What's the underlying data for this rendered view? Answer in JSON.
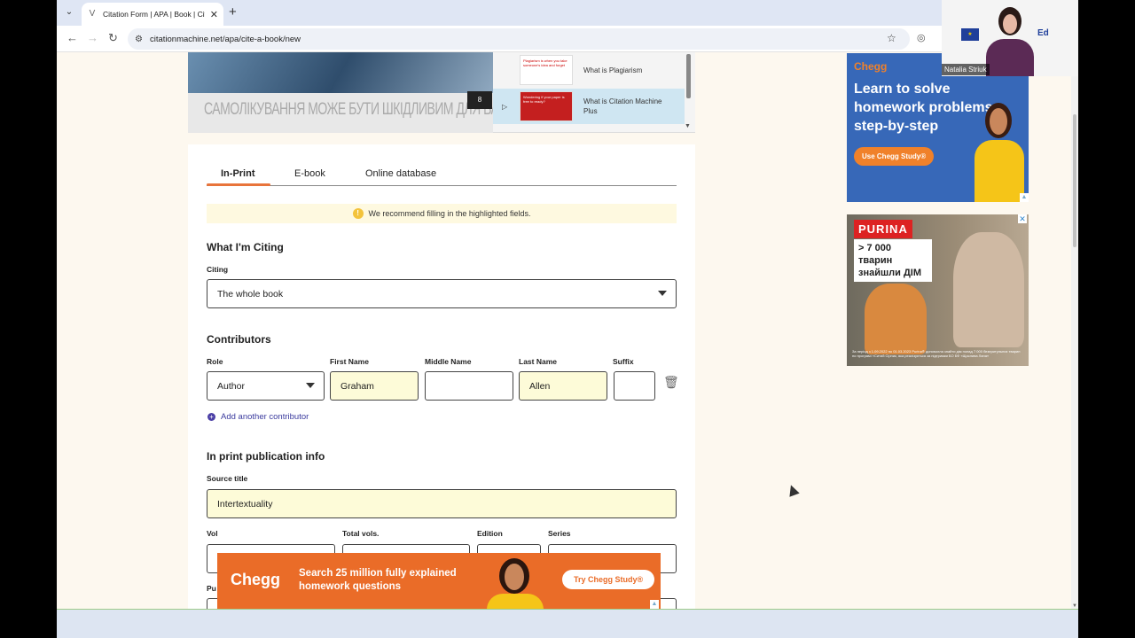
{
  "browser": {
    "tab_title": "Citation Form | APA | Book | Cit",
    "url": "citationmachine.net/apa/cite-a-book/new",
    "newtab": "+",
    "close": "✕",
    "dropdown": "⌄",
    "back": "←",
    "forward": "→",
    "reload": "↻",
    "star": "☆",
    "tune": "⚙"
  },
  "webcam": {
    "name": "Natalia Striuk",
    "logo": "Ed"
  },
  "video": {
    "caption": "САМОЛІКУВАННЯ МОЖЕ БУТИ ШКІДЛИВИМ ДЛЯ ВАШОГО ЗДОРОВ'Я",
    "badge": "8",
    "playlist": [
      {
        "title": "What is Plagiarism",
        "thumb": "Plagiarism is when you take someone's idea and forget"
      },
      {
        "title": "What is Citation Machine Plus",
        "thumb": "Wondering if your paper is free to ready?"
      }
    ]
  },
  "form": {
    "tabs": [
      "In-Print",
      "E-book",
      "Online database"
    ],
    "notice": "We recommend filling in the highlighted fields.",
    "what_citing": {
      "heading": "What I'm Citing",
      "label": "Citing",
      "value": "The whole book"
    },
    "contributors": {
      "heading": "Contributors",
      "role_label": "Role",
      "role_value": "Author",
      "first_label": "First Name",
      "first_value": "Graham",
      "middle_label": "Middle Name",
      "middle_value": "",
      "last_label": "Last Name",
      "last_value": "Allen",
      "suffix_label": "Suffix",
      "suffix_value": "",
      "add_label": "Add another contributor"
    },
    "pub": {
      "heading": "In print publication info",
      "source_label": "Source title",
      "source_value": "Intertextuality",
      "vol_label": "Vol",
      "total_label": "Total vols.",
      "edition_label": "Edition",
      "series_label": "Series",
      "pub_label": "Pu"
    }
  },
  "ads": {
    "chegg_side": {
      "brand": "Chegg",
      "headline": "Learn to solve homework problems step-by-step",
      "button": "Use Chegg Study®"
    },
    "purina": {
      "brand": "PURINA",
      "claim": "> 7 000 тварин знайшли ДІМ",
      "fine": "За період з 1.09.2022 по 01.03.2023 Purina® допомогла знайти дім понад 7 000 безпритульних тварин по програмі «Ситий Сірник, яка реалізується за підтримки БО БФ «Щаслива Лапа»"
    },
    "chegg_banner": {
      "brand": "Chegg",
      "text": "Search 25 million fully explained homework questions",
      "button": "Try Chegg Study®"
    }
  }
}
